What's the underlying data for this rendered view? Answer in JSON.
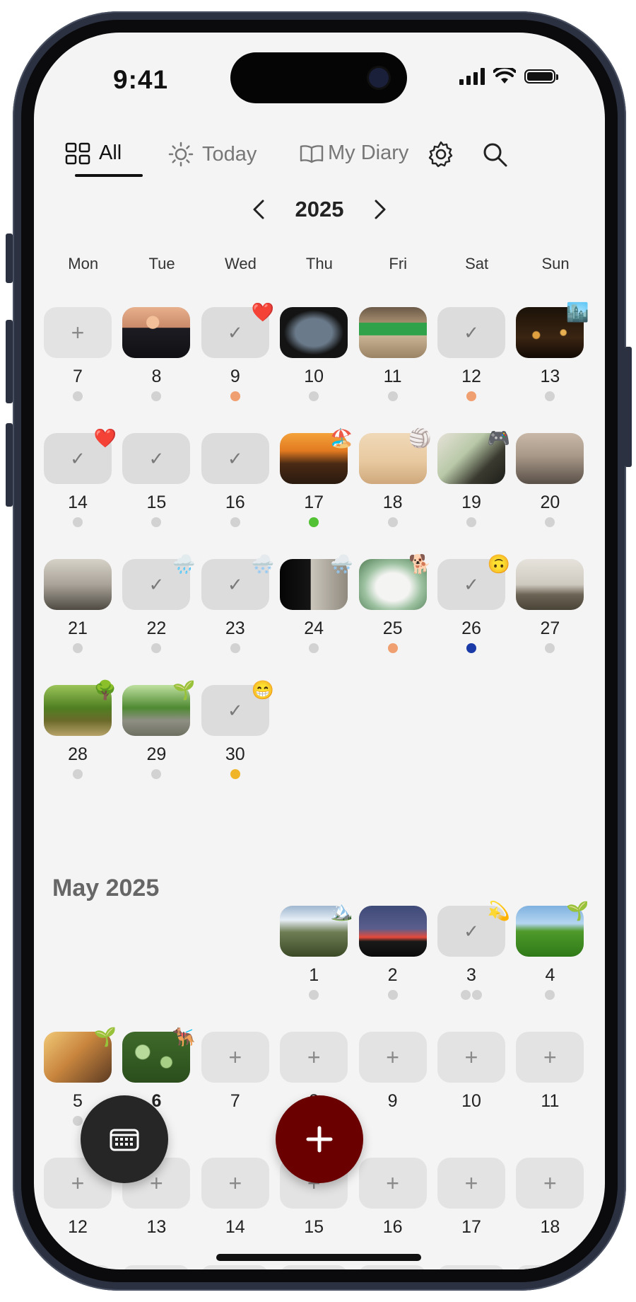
{
  "status_bar": {
    "time": "9:41"
  },
  "tabs": [
    {
      "label": "All",
      "icon": "grid-icon",
      "active": true
    },
    {
      "label": "Today",
      "icon": "sun-icon",
      "active": false
    },
    {
      "label": "My Diary",
      "icon": "book-icon",
      "active": false
    }
  ],
  "toolbar": {
    "settings_icon": "gear-icon",
    "search_icon": "search-icon"
  },
  "year_nav": {
    "year": "2025"
  },
  "weekdays": [
    "Mon",
    "Tue",
    "Wed",
    "Thu",
    "Fri",
    "Sat",
    "Sun"
  ],
  "april_rows": [
    [
      {
        "day": "7",
        "kind": "add",
        "dots": [
          "#d2d2d2"
        ]
      },
      {
        "day": "8",
        "kind": "photo",
        "photo": "silhouettes-sunset",
        "dots": [
          "#d2d2d2"
        ]
      },
      {
        "day": "9",
        "kind": "check",
        "badge": "❤️",
        "dots": [
          "#f0a070"
        ]
      },
      {
        "day": "10",
        "kind": "photo",
        "photo": "airplane-window",
        "dots": [
          "#d2d2d2"
        ]
      },
      {
        "day": "11",
        "kind": "photo",
        "photo": "toy-cart-sand",
        "dots": [
          "#d2d2d2"
        ]
      },
      {
        "day": "12",
        "kind": "check",
        "dots": [
          "#f0a070"
        ]
      },
      {
        "day": "13",
        "kind": "photo",
        "photo": "city-night",
        "badge": "🏙️",
        "dots": [
          "#d2d2d2"
        ]
      }
    ],
    [
      {
        "day": "14",
        "kind": "check",
        "badge": "❤️",
        "dots": [
          "#d2d2d2"
        ]
      },
      {
        "day": "15",
        "kind": "check",
        "dots": [
          "#d2d2d2"
        ]
      },
      {
        "day": "16",
        "kind": "check",
        "dots": [
          "#d2d2d2"
        ]
      },
      {
        "day": "17",
        "kind": "photo",
        "photo": "beach-sunset",
        "badge": "🏖️",
        "dots": [
          "#52c234"
        ]
      },
      {
        "day": "18",
        "kind": "photo",
        "photo": "beach-jump",
        "badge": "🏐",
        "dots": [
          "#d2d2d2"
        ]
      },
      {
        "day": "19",
        "kind": "photo",
        "photo": "board-game",
        "badge": "🎮",
        "dots": [
          "#d2d2d2"
        ]
      },
      {
        "day": "20",
        "kind": "photo",
        "photo": "street-bikes",
        "dots": [
          "#d2d2d2"
        ]
      }
    ],
    [
      {
        "day": "21",
        "kind": "photo",
        "photo": "street-kids",
        "dots": [
          "#d2d2d2"
        ]
      },
      {
        "day": "22",
        "kind": "check",
        "badge": "🌧️",
        "dots": [
          "#d2d2d2"
        ]
      },
      {
        "day": "23",
        "kind": "check",
        "badge": "🌨️",
        "dots": [
          "#d2d2d2"
        ]
      },
      {
        "day": "24",
        "kind": "photo",
        "photo": "dark-room",
        "badge": "🌨️",
        "dots": [
          "#d2d2d2"
        ]
      },
      {
        "day": "25",
        "kind": "photo",
        "photo": "white-dog",
        "badge": "🐕",
        "dots": [
          "#f0a070"
        ]
      },
      {
        "day": "26",
        "kind": "check",
        "badge": "🙃",
        "dots": [
          "#1a3aa8"
        ]
      },
      {
        "day": "27",
        "kind": "photo",
        "photo": "temple-ruins",
        "dots": [
          "#d2d2d2"
        ]
      }
    ],
    [
      {
        "day": "28",
        "kind": "photo",
        "photo": "park-trees",
        "badge": "🌳",
        "dots": [
          "#d2d2d2"
        ]
      },
      {
        "day": "29",
        "kind": "photo",
        "photo": "tree-path",
        "badge": "🌱",
        "dots": [
          "#d2d2d2"
        ]
      },
      {
        "day": "30",
        "kind": "check",
        "badge": "😁",
        "dots": [
          "#f0b429"
        ]
      }
    ]
  ],
  "may_title": "May 2025",
  "may_rows": [
    [
      null,
      null,
      null,
      {
        "day": "1",
        "kind": "photo",
        "photo": "mountain-hike",
        "badge": "🏔️",
        "dots": [
          "#d2d2d2"
        ]
      },
      {
        "day": "2",
        "kind": "photo",
        "photo": "red-sunset",
        "dots": [
          "#d2d2d2"
        ]
      },
      {
        "day": "3",
        "kind": "check",
        "badge": "💫",
        "dots": [
          "#d2d2d2",
          "#d2d2d2"
        ]
      },
      {
        "day": "4",
        "kind": "photo",
        "photo": "green-field-dog",
        "badge": "🌱",
        "dots": [
          "#d2d2d2"
        ]
      }
    ],
    [
      {
        "day": "5",
        "kind": "photo",
        "photo": "reading-kids",
        "badge": "🌱",
        "dots": [
          "#d2d2d2"
        ]
      },
      {
        "day": "6",
        "kind": "photo",
        "photo": "garden-leaves",
        "badge": "🐕‍🦺",
        "bold": true,
        "dots": [
          "#d2d2d2"
        ]
      },
      {
        "day": "7",
        "kind": "add",
        "dots": []
      },
      {
        "day": "8",
        "kind": "add",
        "dots": []
      },
      {
        "day": "9",
        "kind": "add",
        "dots": []
      },
      {
        "day": "10",
        "kind": "add",
        "dots": []
      },
      {
        "day": "11",
        "kind": "add",
        "dots": []
      }
    ],
    [
      {
        "day": "12",
        "kind": "add",
        "dots": []
      },
      {
        "day": "13",
        "kind": "add",
        "dots": []
      },
      {
        "day": "14",
        "kind": "add",
        "dots": []
      },
      {
        "day": "15",
        "kind": "add",
        "dots": []
      },
      {
        "day": "16",
        "kind": "add",
        "dots": []
      },
      {
        "day": "17",
        "kind": "add",
        "dots": []
      },
      {
        "day": "18",
        "kind": "add",
        "dots": []
      }
    ]
  ],
  "fab": {
    "calendar_icon": "keyboard-calendar-icon",
    "add_icon": "plus-icon"
  }
}
